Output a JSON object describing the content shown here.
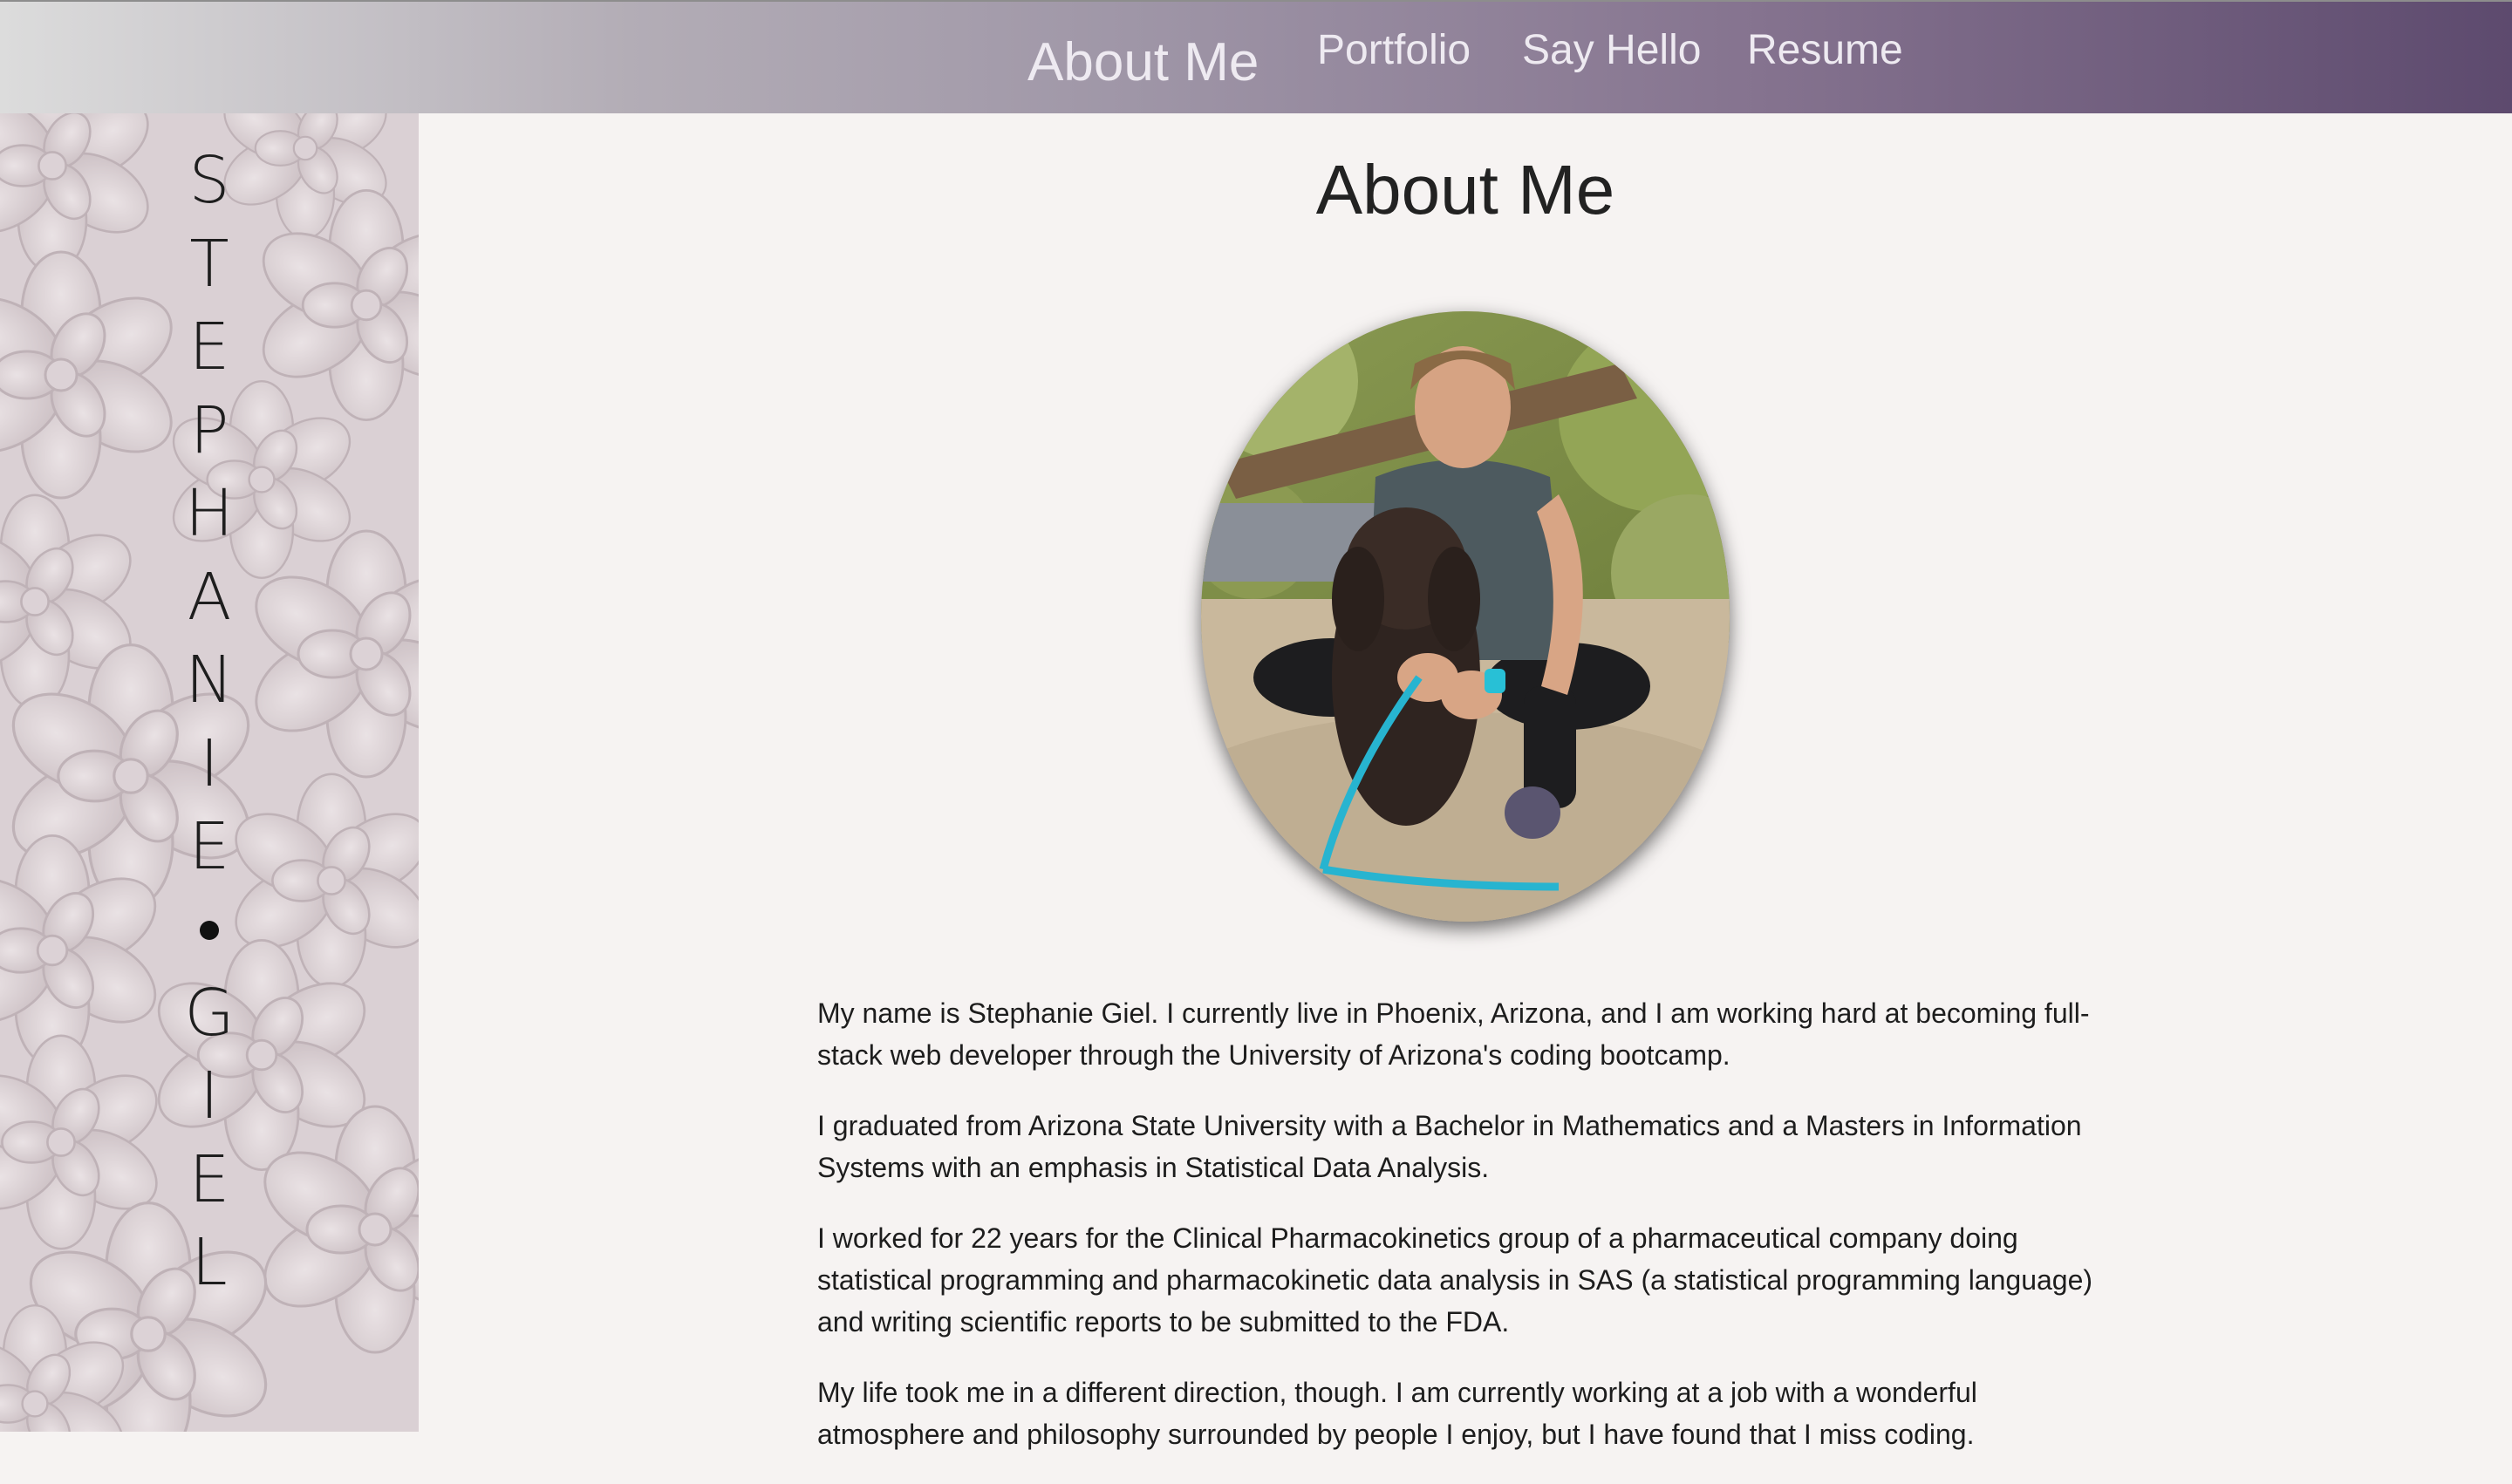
{
  "nav": {
    "active": "About Me",
    "portfolio": "Portfolio",
    "say_hello": "Say Hello",
    "resume": "Resume"
  },
  "sidebar": {
    "name_letters_first": [
      "S",
      "T",
      "E",
      "P",
      "H",
      "A",
      "N",
      "I",
      "E"
    ],
    "name_letters_last": [
      "G",
      "I",
      "E",
      "L"
    ]
  },
  "main": {
    "title": "About Me",
    "paragraphs": [
      "My name is Stephanie Giel. I currently live in Phoenix, Arizona, and I am working hard at becoming full-stack web developer through the University of Arizona's coding bootcamp.",
      "I graduated from Arizona State University with a Bachelor in Mathematics and a Masters in Information Systems with an emphasis in Statistical Data Analysis.",
      "I worked for 22 years for the Clinical Pharmacokinetics group of a pharmaceutical company doing statistical programming and pharmacokinetic data analysis in SAS (a statistical programming language) and writing scientific reports to be submitted to the FDA.",
      "My life took me in a different direction, though. I am currently working at a job with a wonderful atmosphere and philosophy surrounded by people I enjoy, but I have found that I miss coding."
    ]
  },
  "colors": {
    "nav_start": "#dcdcdc",
    "nav_end": "#5d4a6e",
    "background": "#f6f3f2",
    "sidebar": "#d9d0d3"
  }
}
